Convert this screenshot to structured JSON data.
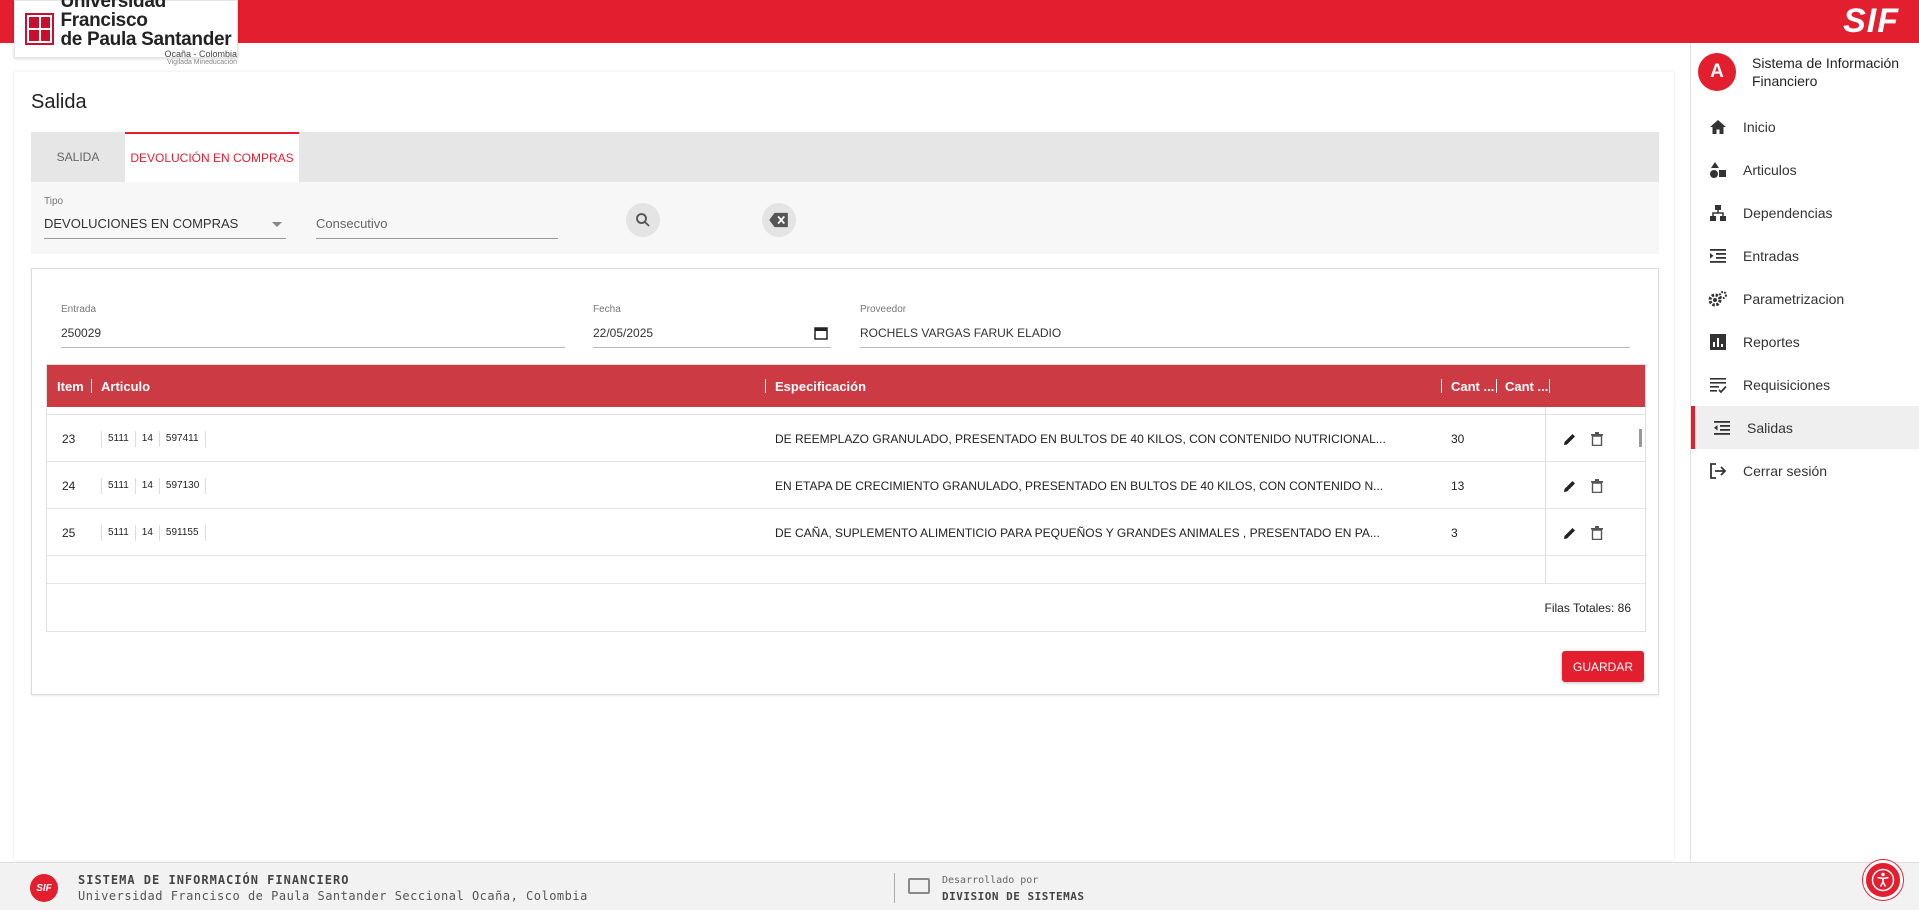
{
  "header": {
    "university_line1": "Universidad Francisco",
    "university_line2": "de Paula Santander",
    "university_line3": "Ocaña - Colombia",
    "university_line4": "Vigilada Mineducación",
    "app_logo": "SIF",
    "brand_color": "#e31e2f"
  },
  "sidebar": {
    "avatar_letter": "A",
    "title": "Sistema de Información Financiero",
    "items": [
      {
        "label": "Inicio",
        "icon": "home-icon"
      },
      {
        "label": "Articulos",
        "icon": "shapes-icon"
      },
      {
        "label": "Dependencias",
        "icon": "sitemap-icon"
      },
      {
        "label": "Entradas",
        "icon": "list-indent-icon"
      },
      {
        "label": "Parametrizacion",
        "icon": "gears-icon"
      },
      {
        "label": "Reportes",
        "icon": "bar-chart-icon"
      },
      {
        "label": "Requisiciones",
        "icon": "checklist-icon"
      },
      {
        "label": "Salidas",
        "icon": "list-outdent-icon",
        "active": true
      },
      {
        "label": "Cerrar sesión",
        "icon": "logout-icon"
      }
    ]
  },
  "main": {
    "title": "Salida",
    "tabs": [
      {
        "label": "Salida"
      },
      {
        "label": "Devolución en compras",
        "active": true
      }
    ],
    "filter": {
      "tipo_label": "Tipo",
      "tipo_value": "DEVOLUCIONES EN COMPRAS",
      "consecutivo_placeholder": "Consecutivo"
    },
    "form": {
      "entrada_label": "Entrada",
      "entrada_value": "250029",
      "fecha_label": "Fecha",
      "fecha_value": "22/05/2025",
      "proveedor_label": "Proveedor",
      "proveedor_value": "ROCHELS VARGAS FARUK ELADIO"
    },
    "table": {
      "columns": [
        "Item",
        "Articulo",
        "Especificación",
        "Cant ...",
        "Cant ..."
      ],
      "rows": [
        {
          "item": "23",
          "codes": [
            "5111",
            "14",
            "597411"
          ],
          "spec": "DE REEMPLAZO GRANULADO, PRESENTADO EN BULTOS DE 40 KILOS, CON CONTENIDO NUTRICIONAL...",
          "qty": "30"
        },
        {
          "item": "24",
          "codes": [
            "5111",
            "14",
            "597130"
          ],
          "spec": "EN ETAPA DE CRECIMIENTO GRANULADO, PRESENTADO EN BULTOS DE 40 KILOS, CON CONTENIDO N...",
          "qty": "13"
        },
        {
          "item": "25",
          "codes": [
            "5111",
            "14",
            "591155"
          ],
          "spec": "DE CAÑA, SUPLEMENTO ALIMENTICIO PARA PEQUEÑOS Y GRANDES ANIMALES , PRESENTADO EN PA...",
          "qty": "3"
        }
      ],
      "total_label": "Filas Totales: 86"
    },
    "save_label": "Guardar"
  },
  "footer": {
    "logo_text": "SIF",
    "title": "SISTEMA DE INFORMACIÓN FINANCIERO",
    "subtitle": "Universidad Francisco de Paula Santander Seccional Ocaña, Colombia",
    "dev_by": "Desarrollado por",
    "dev_name": "DIVISION DE SISTEMAS"
  }
}
